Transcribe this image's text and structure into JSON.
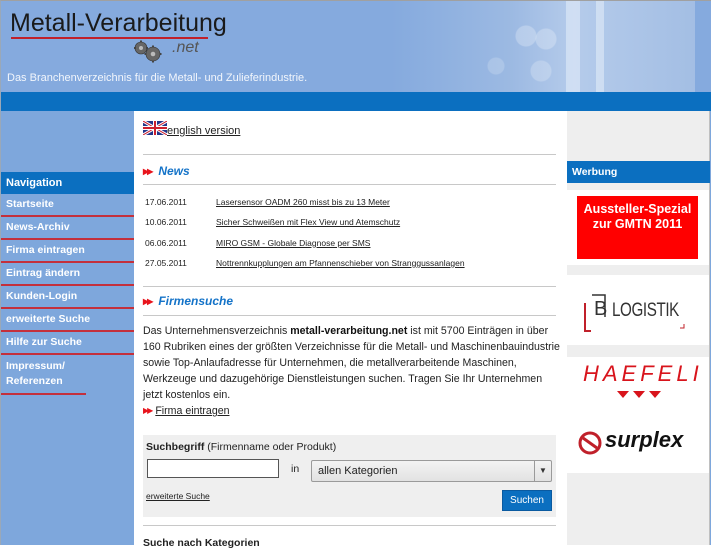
{
  "header": {
    "logo_title": "Metall-Verarbeitung",
    "logo_suffix": ".net",
    "tagline": "Das Branchenverzeichnis für die Metall- und Zulieferindustrie."
  },
  "nav": {
    "heading": "Navigation",
    "items": [
      {
        "label": "Startseite"
      },
      {
        "label": "News-Archiv"
      },
      {
        "label": "Firma eintragen"
      },
      {
        "label": "Eintrag ändern"
      },
      {
        "label": "Kunden-Login"
      },
      {
        "label": "erweiterte Suche"
      },
      {
        "label": "Hilfe zur Suche"
      },
      {
        "label": "Impressum/ Referenzen"
      }
    ]
  },
  "main": {
    "english_link": "english version",
    "news_title": "News",
    "news": [
      {
        "date": "17.06.2011",
        "title": "Lasersensor OADM 260 misst bis zu 13 Meter"
      },
      {
        "date": "10.06.2011",
        "title": "Sicher Schweißen mit Flex View und Atemschutz"
      },
      {
        "date": "06.06.2011",
        "title": "MIRO GSM - Globale Diagnose per SMS"
      },
      {
        "date": "27.05.2011",
        "title": "Nottrennkupplungen am Pfannenschieber von Stranggussanlagen"
      }
    ],
    "search_title": "Firmensuche",
    "intro_prefix": "Das Unternehmensverzeichnis ",
    "intro_bold": "metall-verarbeitung.net",
    "intro_suffix": " ist mit 5700 Einträgen in über 160 Rubriken eines der größten Verzeichnisse für die Metall- und Maschinenbauindustrie sowie Top-Anlaufadresse für Unternehmen, die metallverarbeitende Maschinen, Werkzeuge und dazugehörige Dienstleistungen suchen. Tragen Sie Ihr Unternehmen jetzt kostenlos ein.",
    "register_link": "Firma eintragen",
    "search": {
      "label_bold": "Suchbegriff",
      "label_rest": " (Firmenname oder Produkt)",
      "input_value": "",
      "in_label": "in",
      "category_selected": "allen Kategorien",
      "extended_link": "erweiterte Suche",
      "submit_label": "Suchen"
    },
    "categories_title": "Suche nach Kategorien"
  },
  "sidebar": {
    "heading": "Werbung",
    "ads": [
      {
        "name": "Aussteller-Spezial zur GMTN 2011",
        "line1": "Aussteller-Spezial",
        "line2": "zur GMTN 2011",
        "color": "#ff0000"
      },
      {
        "name": "B LOGISTIK",
        "letter": "B",
        "text": "LOGISTIK"
      },
      {
        "name": "HAEFELI",
        "text": "HAEFELI",
        "color": "#d8141c"
      },
      {
        "name": "surplex",
        "text": "surplex",
        "color": "#c0202a"
      }
    ]
  },
  "colors": {
    "brand_blue": "#0b6fc0",
    "nav_bg": "#7ea7dc",
    "accent_red": "#e8141c",
    "section_title": "#1473c8"
  }
}
